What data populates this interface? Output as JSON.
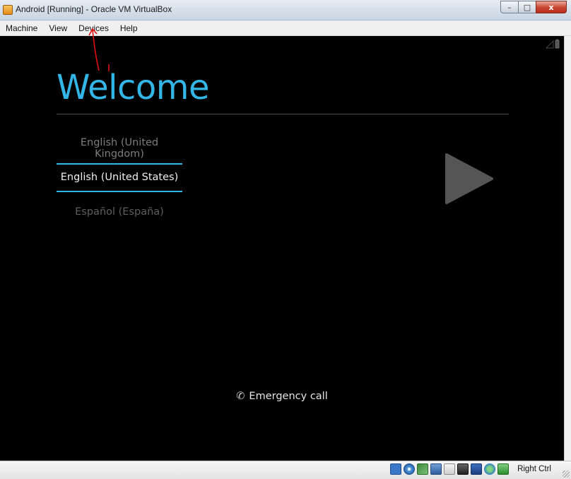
{
  "window": {
    "title": "Android [Running] - Oracle VM VirtualBox",
    "controls": {
      "minimize": "–",
      "maximize": "□",
      "close": "x"
    }
  },
  "menubar": {
    "items": [
      {
        "label": "Machine"
      },
      {
        "label": "View"
      },
      {
        "label": "Devices"
      },
      {
        "label": "Help"
      }
    ]
  },
  "android": {
    "welcome": "Welcome",
    "languages": [
      {
        "label": "English (United Kingdom)"
      },
      {
        "label": "English (United States)"
      },
      {
        "label": "Español (España)"
      }
    ],
    "emergency_call": "Emergency call",
    "accent_color": "#33b5e5"
  },
  "statusbar": {
    "host_key": "Right Ctrl",
    "icons": [
      "hard-disk-icon",
      "optical-drive-icon",
      "usb-icon",
      "network-icon",
      "shared-folder-icon",
      "video-capture-icon",
      "audio-icon",
      "mouse-integration-icon",
      "keyboard-capture-icon"
    ]
  }
}
